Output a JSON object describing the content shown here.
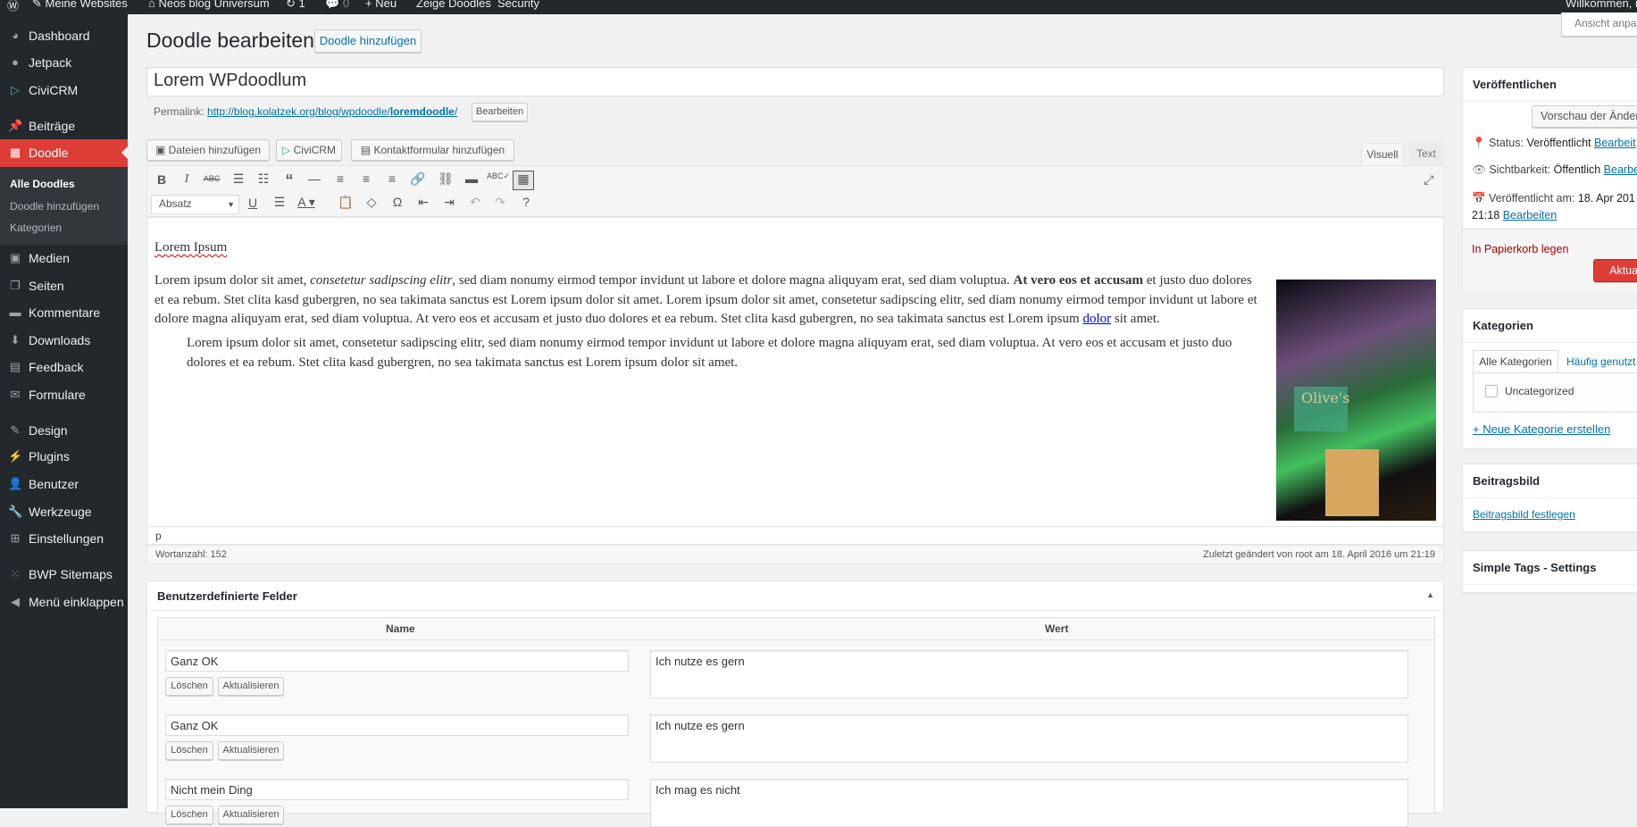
{
  "adminbar": {
    "items": [
      "Meine Websites",
      "Neos blog Universum",
      "1",
      "0",
      "Neu",
      "Zeige Doodles",
      "Security"
    ],
    "greeting": "Willkommen, r",
    "screen_options": "Ansicht anpa"
  },
  "sidebar": {
    "items": [
      "Dashboard",
      "Jetpack",
      "CiviCRM",
      "Beiträge",
      "Doodle",
      "Medien",
      "Seiten",
      "Kommentare",
      "Downloads",
      "Feedback",
      "Formulare",
      "Design",
      "Plugins",
      "Benutzer",
      "Werkzeuge",
      "Einstellungen",
      "BWP Sitemaps",
      "Menü einklappen"
    ],
    "submenu": [
      "Alle Doodles",
      "Doodle hinzufügen",
      "Kategorien"
    ],
    "accent": "#dd3d36"
  },
  "header": {
    "title": "Doodle bearbeiten",
    "add_new": "Doodle hinzufügen"
  },
  "post": {
    "title": "Lorem WPdoodlum",
    "permalink_label": "Permalink:",
    "permalink_base": "http://blog.kolatzek.org/blog/wpdoodle/",
    "permalink_slug": "loremdoodle",
    "permalink_suffix": "/",
    "edit_label": "Bearbeiten"
  },
  "media_buttons": [
    "Dateien hinzufügen",
    "CiviCRM",
    "Kontaktformular hinzufügen"
  ],
  "editor_tabs": [
    "Visuell",
    "Text"
  ],
  "format_select": "Absatz",
  "content": {
    "heading": "Lorem Ipsum",
    "p1_a": "Lorem ipsum dolor sit amet, ",
    "p1_italic": "consetetur sadipscing elitr",
    "p1_b": ", sed diam nonumy eirmod tempor invidunt ut labore et dolore magna aliquyam erat, sed diam voluptua. ",
    "p1_bold": "At vero eos et accusam",
    "p1_c": " et justo duo dolores et ea rebum. Stet clita kasd gubergren, no sea takimata sanctus est Lorem ipsum dolor sit amet. Lorem ipsum dolor sit amet, consetetur sadipscing elitr, sed diam nonumy eirmod tempor invidunt ut labore et dolore magna aliquyam erat, sed diam voluptua. At vero eos et accusam et justo duo dolores et ea rebum. Stet clita kasd gubergren, no sea takimata sanctus est Lorem ipsum ",
    "p1_link": "dolor",
    "p1_d": " sit amet.",
    "quote": "Lorem ipsum dolor sit amet, consetetur sadipscing elitr, sed diam nonumy eirmod tempor invidunt ut labore et dolore magna aliquyam erat, sed diam voluptua. At vero eos et accusam et justo duo dolores et ea rebum. Stet clita kasd gubergren, no sea takimata sanctus est Lorem ipsum dolor sit amet.",
    "image_sign": "Olive's"
  },
  "status": {
    "path": "p",
    "wordcount": "Wortanzahl: 152",
    "last_edit": "Zuletzt geändert von root am 18. April 2016 um 21:19"
  },
  "custom_fields": {
    "title": "Benutzerdefinierte Felder",
    "col_name": "Name",
    "col_value": "Wert",
    "delete": "Löschen",
    "update": "Aktualisieren",
    "rows": [
      {
        "name": "Ganz OK",
        "value": "Ich nutze es gern"
      },
      {
        "name": "Ganz OK",
        "value": "Ich nutze es gern"
      },
      {
        "name": "Nicht mein Ding",
        "value": "Ich mag es nicht"
      }
    ]
  },
  "publish": {
    "title": "Veröffentlichen",
    "preview": "Vorschau der Änder",
    "status_label": "Status:",
    "status": "Veröffentlicht",
    "visibility_label": "Sichtbarkeit:",
    "visibility": "Öffentlich",
    "date_label": "Veröffentlicht am:",
    "date": "18. Apr 201",
    "time": "21:18",
    "edit": "Bearbeiten",
    "edit_short": "Bearbeit",
    "edit_short2": "Bearbe",
    "trash": "In Papierkorb legen",
    "update": "Aktualis"
  },
  "categories": {
    "title": "Kategorien",
    "tab_all": "Alle Kategorien",
    "tab_popular": "Häufig genutzt",
    "items": [
      "Uncategorized"
    ],
    "add_new": "+ Neue Kategorie erstellen"
  },
  "featured_image": {
    "title": "Beitragsbild",
    "set": "Beitragsbild festlegen"
  },
  "simple_tags": {
    "title": "Simple Tags - Settings"
  }
}
